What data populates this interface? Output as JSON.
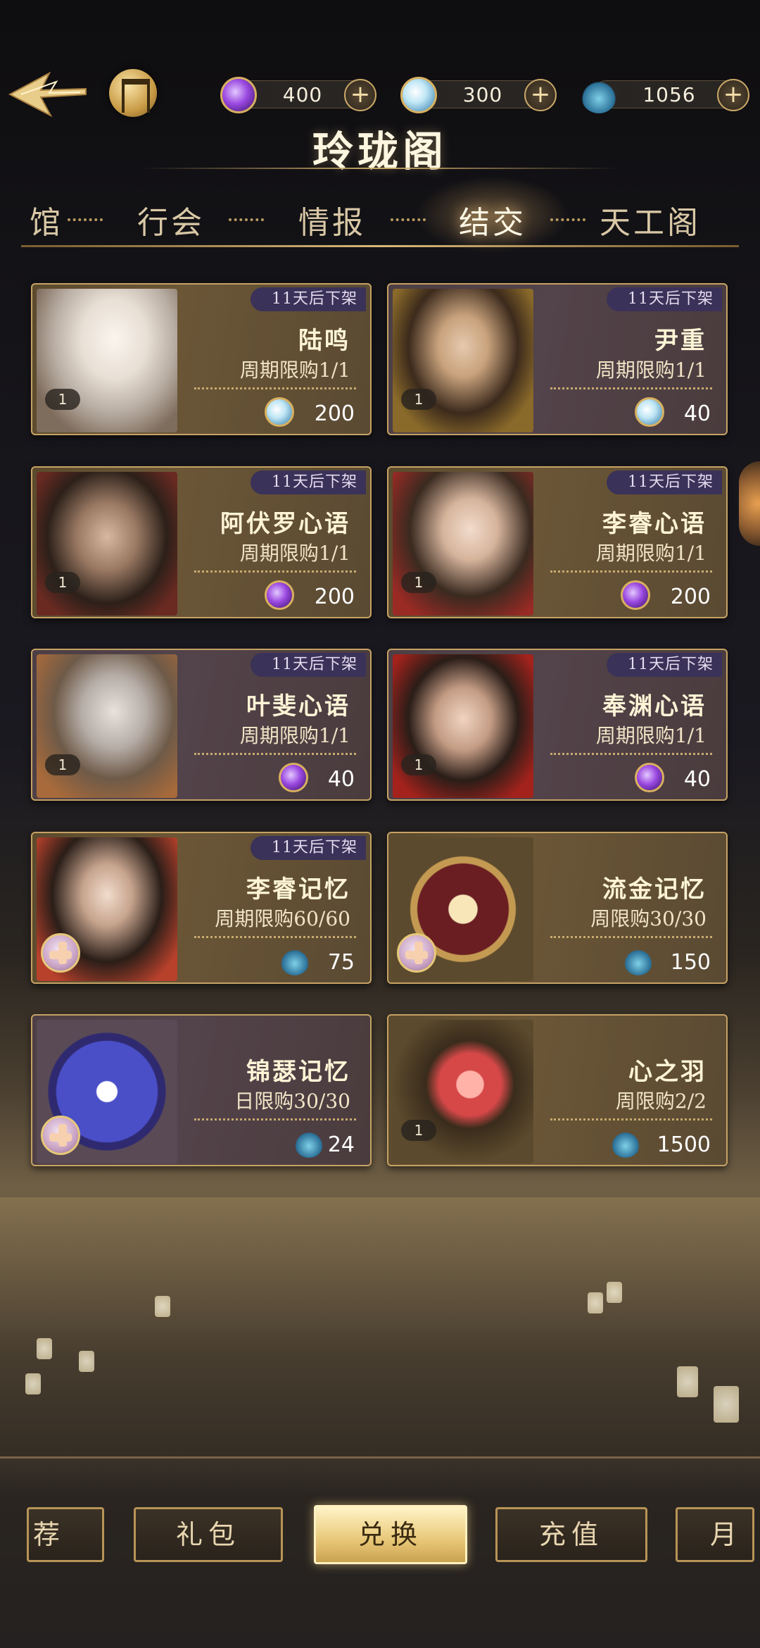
{
  "header": {
    "title": "玲珑阁",
    "currencies": [
      {
        "icon": "purple-gem-icon",
        "value": "400"
      },
      {
        "icon": "blue-pearl-icon",
        "value": "300"
      },
      {
        "icon": "potion-bottle-icon",
        "value": "1056"
      }
    ],
    "plus_label": "+"
  },
  "tabs": [
    {
      "label": "馆",
      "active": false
    },
    {
      "label": "行会",
      "active": false
    },
    {
      "label": "情报",
      "active": false
    },
    {
      "label": "结交",
      "active": true
    },
    {
      "label": "天工阁",
      "active": false
    }
  ],
  "cards": [
    {
      "tag": "11天后下架",
      "name": "陆鸣",
      "limit": "周期限购1/1",
      "price": "200",
      "currency": "blue-pearl-icon",
      "badge": "1"
    },
    {
      "tag": "11天后下架",
      "name": "尹重",
      "limit": "周期限购1/1",
      "price": "40",
      "currency": "blue-pearl-icon",
      "badge": "1"
    },
    {
      "tag": "11天后下架",
      "name": "阿伏罗心语",
      "limit": "周期限购1/1",
      "price": "200",
      "currency": "purple-gem-icon",
      "badge": "1"
    },
    {
      "tag": "11天后下架",
      "name": "李睿心语",
      "limit": "周期限购1/1",
      "price": "200",
      "currency": "purple-gem-icon",
      "badge": "1"
    },
    {
      "tag": "11天后下架",
      "name": "叶斐心语",
      "limit": "周期限购1/1",
      "price": "40",
      "currency": "purple-gem-icon",
      "badge": "1"
    },
    {
      "tag": "11天后下架",
      "name": "奉渊心语",
      "limit": "周期限购1/1",
      "price": "40",
      "currency": "purple-gem-icon",
      "badge": "1"
    },
    {
      "tag": "11天后下架",
      "name": "李睿记忆",
      "limit": "周期限购60/60",
      "price": "75",
      "currency": "potion-bottle-icon",
      "badge": ""
    },
    {
      "tag": "",
      "name": "流金记忆",
      "limit": "周限购30/30",
      "price": "150",
      "currency": "potion-bottle-icon",
      "badge": ""
    },
    {
      "tag": "",
      "name": "锦瑟记忆",
      "limit": "日限购30/30",
      "price": "24",
      "currency": "potion-bottle-icon",
      "badge": ""
    },
    {
      "tag": "",
      "name": "心之羽",
      "limit": "周限购2/2",
      "price": "1500",
      "currency": "potion-bottle-icon",
      "badge": "1"
    }
  ],
  "bottom_nav": [
    {
      "label": "荐",
      "active": false
    },
    {
      "label": "礼包",
      "active": false
    },
    {
      "label": "兑换",
      "active": true
    },
    {
      "label": "充值",
      "active": false
    },
    {
      "label": "月",
      "active": false
    }
  ],
  "colors": {
    "accent_gold": "#c6a264",
    "tag_bg": "#3a3258",
    "active_nav": "#e8c878"
  }
}
